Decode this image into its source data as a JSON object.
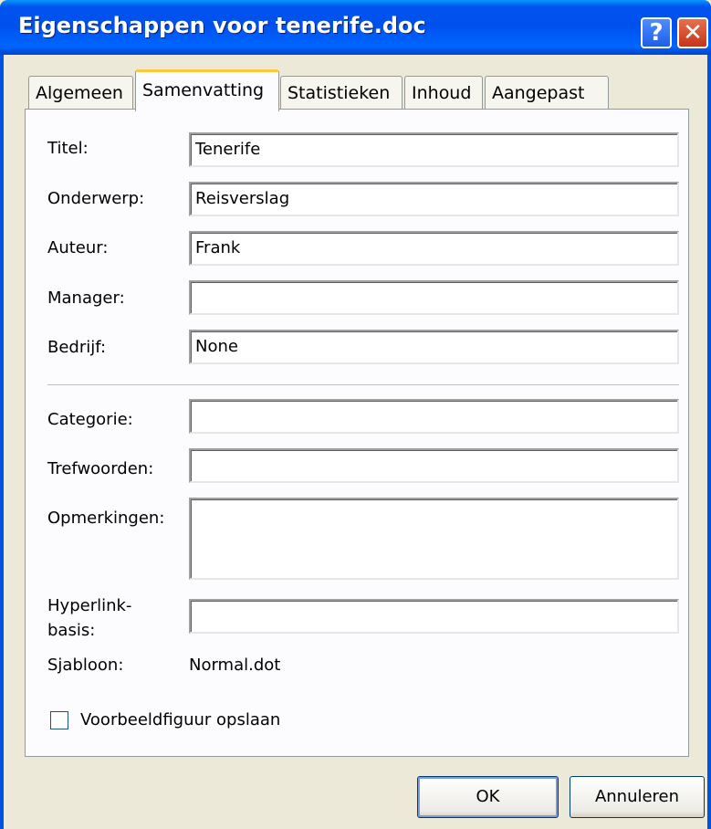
{
  "window": {
    "title": "Eigenschappen voor tenerife.doc",
    "help_glyph": "?",
    "close_glyph": "✕"
  },
  "tabs": [
    {
      "label": "Algemeen"
    },
    {
      "label": "Samenvatting",
      "active": true
    },
    {
      "label": "Statistieken"
    },
    {
      "label": "Inhoud"
    },
    {
      "label": "Aangepast"
    }
  ],
  "fields": {
    "titel": {
      "label": "Titel:",
      "value": "Tenerife"
    },
    "onderwerp": {
      "label": "Onderwerp:",
      "value": "Reisverslag"
    },
    "auteur": {
      "label": "Auteur:",
      "value": "Frank"
    },
    "manager": {
      "label": "Manager:",
      "value": ""
    },
    "bedrijf": {
      "label": "Bedrijf:",
      "value": "None"
    },
    "categorie": {
      "label": "Categorie:",
      "value": ""
    },
    "trefwoorden": {
      "label": "Trefwoorden:",
      "value": ""
    },
    "opmerkingen": {
      "label": "Opmerkingen:",
      "value": ""
    },
    "hyperlinkbasis": {
      "label_line1": "Hyperlink-",
      "label_line2": "basis:",
      "value": ""
    }
  },
  "template": {
    "label": "Sjabloon:",
    "value": "Normal.dot"
  },
  "thumbnail_checkbox": {
    "label": "Voorbeeldfiguur opslaan",
    "checked": false
  },
  "buttons": {
    "ok": "OK",
    "cancel": "Annuleren"
  },
  "colors": {
    "titlebar": "#0054e3",
    "face": "#ece9d8",
    "active_tab_accent": "#ffc83c"
  }
}
